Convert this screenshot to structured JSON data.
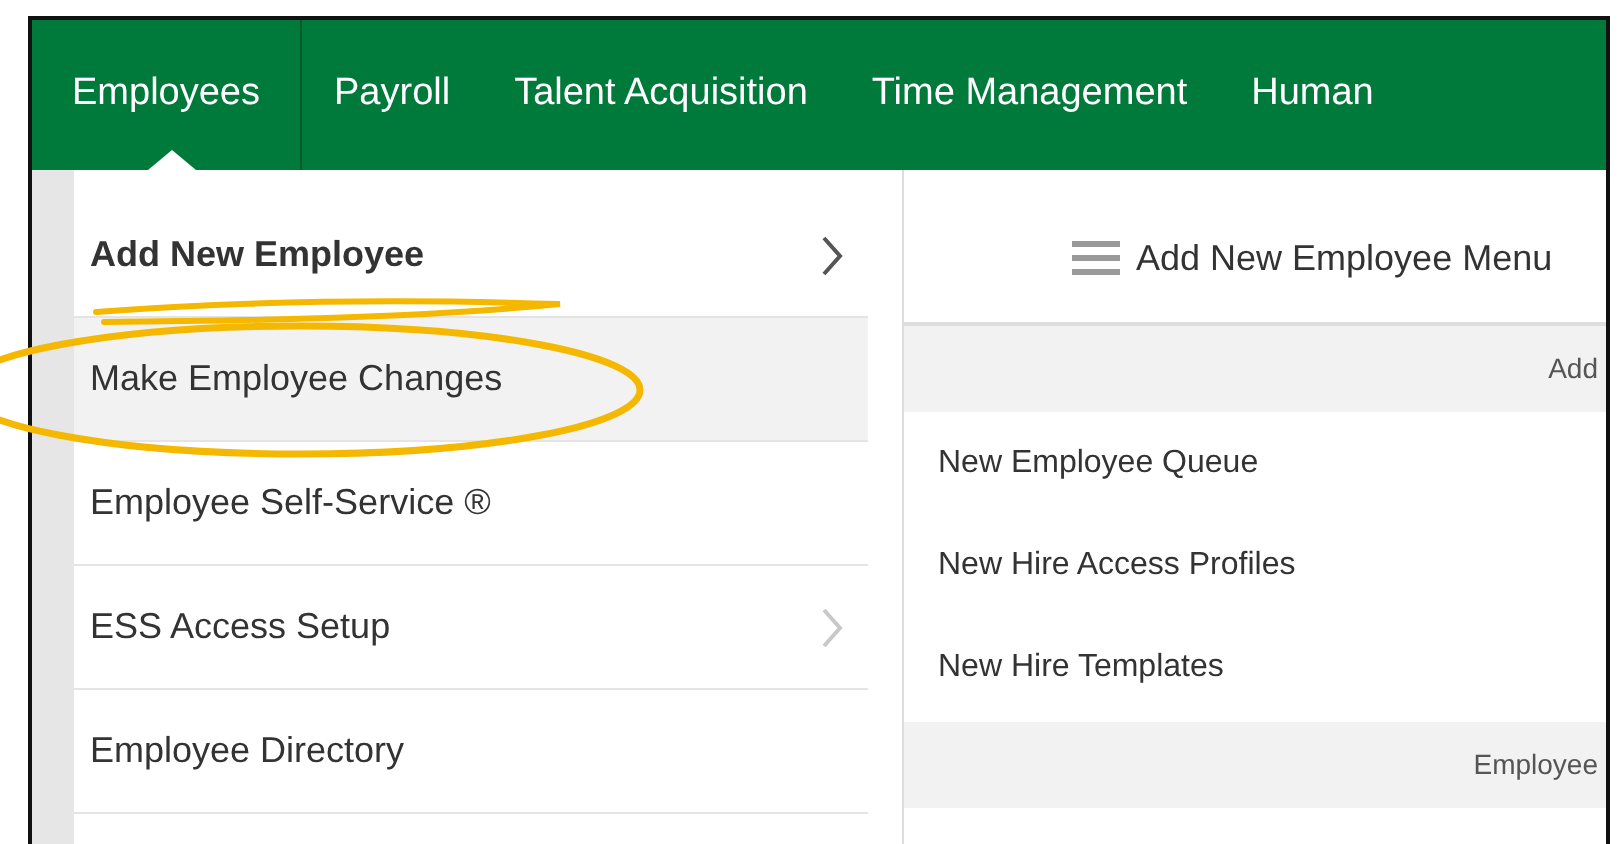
{
  "nav": [
    {
      "label": "Employees",
      "selected": true
    },
    {
      "label": "Payroll",
      "selected": false
    },
    {
      "label": "Talent Acquisition",
      "selected": false
    },
    {
      "label": "Time Management",
      "selected": false
    },
    {
      "label": "Human",
      "selected": false
    }
  ],
  "menu": [
    {
      "label": "Add New Employee",
      "selected": false,
      "expanded": true,
      "submenu": true
    },
    {
      "label": "Make Employee Changes",
      "selected": true,
      "expanded": false,
      "submenu": false
    },
    {
      "label": "Employee Self-Service ®",
      "selected": false,
      "expanded": false,
      "submenu": false
    },
    {
      "label": "ESS Access Setup",
      "selected": false,
      "expanded": false,
      "submenu": true
    },
    {
      "label": "Employee Directory",
      "selected": false,
      "expanded": false,
      "submenu": false
    }
  ],
  "submenu": {
    "title": "Add New Employee Menu",
    "sections": [
      {
        "heading": "Add",
        "items": [
          "New Employee Queue",
          "New Hire Access Profiles",
          "New Hire Templates"
        ]
      },
      {
        "heading": "Employee"
      }
    ]
  }
}
